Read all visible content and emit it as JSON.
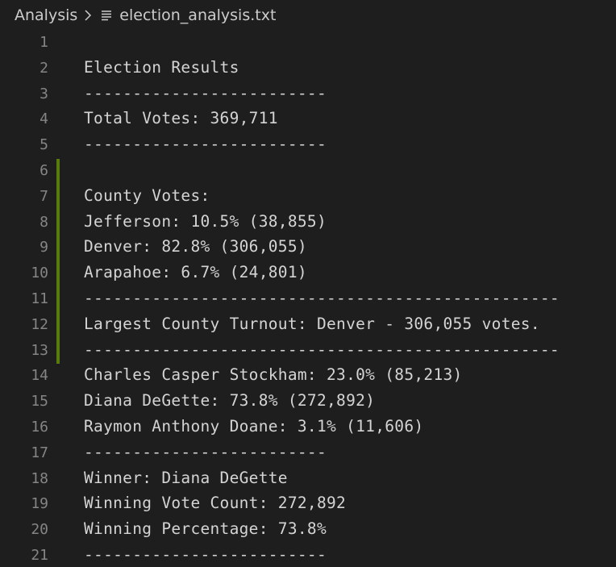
{
  "breadcrumb": {
    "folder": "Analysis",
    "separator": "›",
    "file_icon": "text-file-icon",
    "file": "election_analysis.txt"
  },
  "editor": {
    "lines": [
      {
        "number": "1",
        "text": ""
      },
      {
        "number": "2",
        "text": "Election Results"
      },
      {
        "number": "3",
        "text": "-------------------------"
      },
      {
        "number": "4",
        "text": "Total Votes: 369,711"
      },
      {
        "number": "5",
        "text": "-------------------------"
      },
      {
        "number": "6",
        "text": ""
      },
      {
        "number": "7",
        "text": "County Votes:"
      },
      {
        "number": "8",
        "text": "Jefferson: 10.5% (38,855)"
      },
      {
        "number": "9",
        "text": "Denver: 82.8% (306,055)"
      },
      {
        "number": "10",
        "text": "Arapahoe: 6.7% (24,801)"
      },
      {
        "number": "11",
        "text": "-------------------------------------------------"
      },
      {
        "number": "12",
        "text": "Largest County Turnout: Denver - 306,055 votes."
      },
      {
        "number": "13",
        "text": "-------------------------------------------------"
      },
      {
        "number": "14",
        "text": "Charles Casper Stockham: 23.0% (85,213)"
      },
      {
        "number": "15",
        "text": "Diana DeGette: 73.8% (272,892)"
      },
      {
        "number": "16",
        "text": "Raymon Anthony Doane: 3.1% (11,606)"
      },
      {
        "number": "17",
        "text": "-------------------------"
      },
      {
        "number": "18",
        "text": "Winner: Diana DeGette"
      },
      {
        "number": "19",
        "text": "Winning Vote Count: 272,892"
      },
      {
        "number": "20",
        "text": "Winning Percentage: 73.8%"
      },
      {
        "number": "21",
        "text": "-------------------------"
      }
    ],
    "modified_gutter_color": "#587c0c"
  }
}
